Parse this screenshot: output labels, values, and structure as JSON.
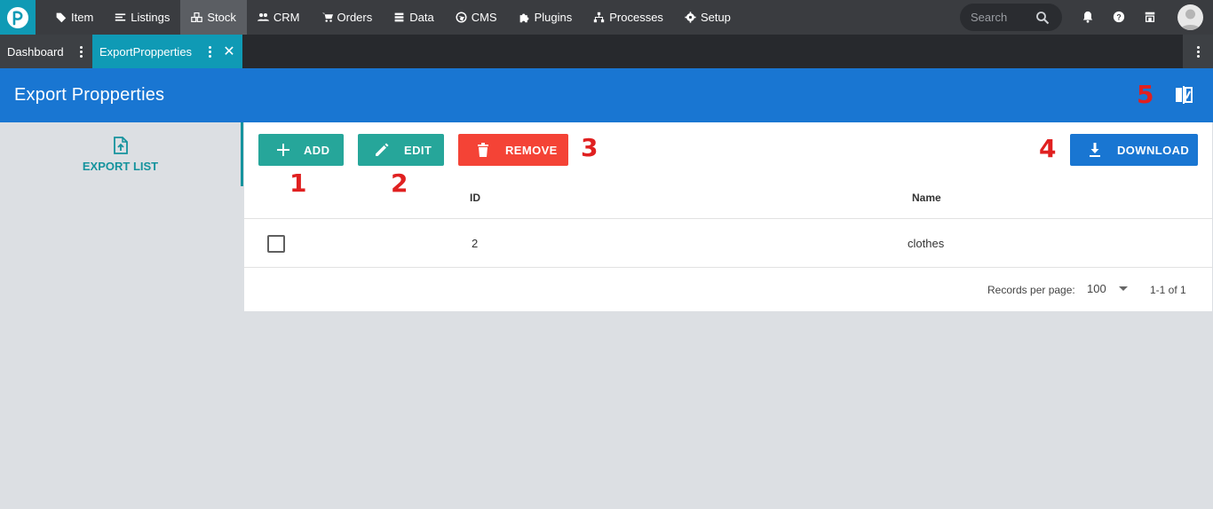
{
  "topnav": {
    "items": [
      {
        "label": "Item",
        "icon": "tag-icon"
      },
      {
        "label": "Listings",
        "icon": "listings-icon"
      },
      {
        "label": "Stock",
        "icon": "stock-icon",
        "active": true
      },
      {
        "label": "CRM",
        "icon": "people-icon"
      },
      {
        "label": "Orders",
        "icon": "cart-icon"
      },
      {
        "label": "Data",
        "icon": "database-icon"
      },
      {
        "label": "CMS",
        "icon": "globe-icon"
      },
      {
        "label": "Plugins",
        "icon": "puzzle-icon"
      },
      {
        "label": "Processes",
        "icon": "process-icon"
      },
      {
        "label": "Setup",
        "icon": "gear-icon"
      }
    ],
    "search_placeholder": "Search"
  },
  "tabs": [
    {
      "label": "Dashboard",
      "active": false
    },
    {
      "label": "ExportPropperties",
      "active": true
    }
  ],
  "header": {
    "title": "Export Propperties"
  },
  "sidebar": {
    "items": [
      {
        "label": "EXPORT LIST",
        "icon": "file-upload-icon"
      }
    ]
  },
  "toolbar": {
    "add_label": "ADD",
    "edit_label": "EDIT",
    "remove_label": "REMOVE",
    "download_label": "DOWNLOAD"
  },
  "markers": [
    "1",
    "2",
    "3",
    "4",
    "5"
  ],
  "table": {
    "columns": [
      "ID",
      "Name"
    ],
    "rows": [
      {
        "id": "2",
        "name": "clothes"
      }
    ]
  },
  "pagination": {
    "records_label": "Records per page:",
    "per_page": "100",
    "range": "1-1 of 1"
  },
  "colors": {
    "topnav": "#3a3c40",
    "tab_active": "#0f9ab5",
    "header": "#1976d2",
    "teal_button": "#26a69a",
    "remove_button": "#f44336",
    "download_button": "#1976d2",
    "marker": "#e02020"
  }
}
